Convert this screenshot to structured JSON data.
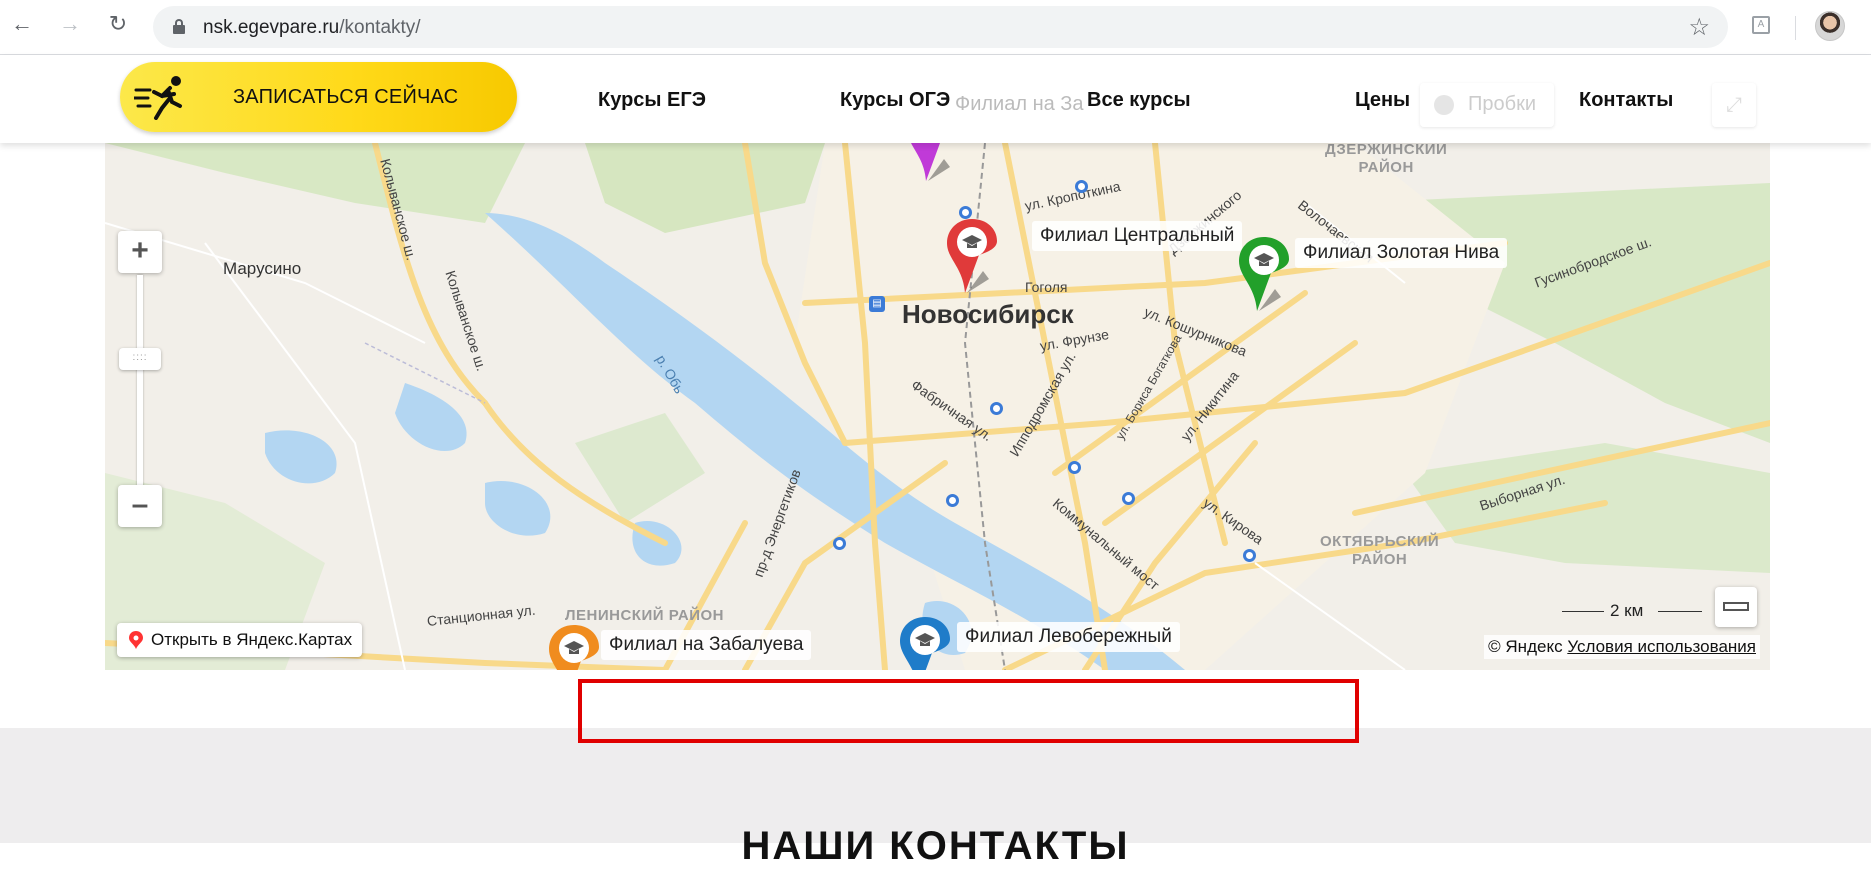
{
  "browser": {
    "url_host": "nsk.egevpare.ru",
    "url_path": "/kontakty/"
  },
  "header": {
    "cta_label": "ЗАПИСАТЬСЯ СЕЙЧАС",
    "nav": [
      "Курсы ЕГЭ",
      "Курсы ОГЭ",
      "Все курсы",
      "Цены",
      "Контакты"
    ]
  },
  "map": {
    "city": "Новосибирск",
    "places": {
      "marusino": "Марусино",
      "river": "р. Обь"
    },
    "districts": {
      "dzerzhinsky": "ДЗЕРЖИНСКИЙ\nРАЙОН",
      "oktyabrsky": "ОКТЯБРЬСКИЙ\nРАЙОН",
      "leninsky": "ЛЕНИНСКИЙ РАЙОН"
    },
    "streets": {
      "kolyvanskoe1": "Колыванское ш.",
      "kolyvanskoe2": "Колыванское ш.",
      "kropotkina": "ул. Кропоткина",
      "dzerzhinskogo": "Дзержинского",
      "volochaevskaya": "Волочаевская",
      "gusinobrodskoe": "Гусинобродское ш.",
      "frunze": "ул. Фрунзе",
      "koshurnikova": "ул. Кошурникова",
      "gogolya": "Гоголя",
      "fabrichnaya": "Фабричная ул.",
      "ippodromskaya": "Ипподромская ул.",
      "bogatkova": "ул. Бориса Богаткова",
      "nikitina": "ул. Никитина",
      "energetikov": "пр-д Энергетиков",
      "kommunalny": "Коммунальный мост",
      "kirova": "ул. Кирова",
      "vybornaya": "Выборная ул.",
      "stantsionnaya": "Станционная ул.",
      "stantsionnaya2": "Станци..."
    },
    "branches": [
      {
        "label": "Филиал Центральный",
        "color": "#e03a3a"
      },
      {
        "label": "Филиал Золотая Нива",
        "color": "#22a02a"
      },
      {
        "label": "Филиал на Забалуева",
        "color": "#f08c1e"
      },
      {
        "label": "Филиал Левобережный",
        "color": "#1f7cc9"
      },
      {
        "label": "Филиал на Заельцовской",
        "color": "#c03ad8"
      }
    ],
    "faded_branch_label": "Филиал на За",
    "traffic_label": "Пробки",
    "open_in_yandex": "Открыть в Яндекс.Картах",
    "scale_label": "2 км",
    "copyright_prefix": "© Яндекс",
    "terms_link": "Условия использования"
  },
  "contacts_title": "НАШИ КОНТАКТЫ"
}
